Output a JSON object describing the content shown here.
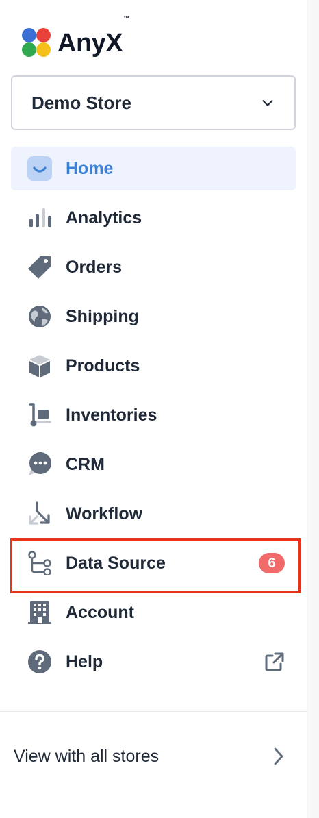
{
  "brand": {
    "name": "AnyX",
    "trademark": "™",
    "logo_colors": [
      "#3b6fd4",
      "#e8413a",
      "#2fa84f",
      "#f5c01a"
    ]
  },
  "store_selector": {
    "value": "Demo Store",
    "icon": "chevron-down-icon"
  },
  "nav": {
    "items": [
      {
        "label": "Home",
        "icon": "home-smile-icon",
        "active": true
      },
      {
        "label": "Analytics",
        "icon": "bar-chart-icon"
      },
      {
        "label": "Orders",
        "icon": "tag-icon"
      },
      {
        "label": "Shipping",
        "icon": "globe-icon"
      },
      {
        "label": "Products",
        "icon": "box-icon"
      },
      {
        "label": "Inventories",
        "icon": "hand-truck-icon"
      },
      {
        "label": "CRM",
        "icon": "chat-bubble-icon"
      },
      {
        "label": "Workflow",
        "icon": "workflow-arrow-icon"
      },
      {
        "label": "Data Source",
        "icon": "git-branch-icon",
        "badge": "6"
      },
      {
        "label": "Account",
        "icon": "building-icon"
      },
      {
        "label": "Help",
        "icon": "question-circle-icon",
        "trailing_icon": "external-link-icon"
      }
    ]
  },
  "footer": {
    "all_stores_label": "View with all stores",
    "icon": "chevron-right-icon"
  },
  "colors": {
    "active_bg": "#eef3fd",
    "active_text": "#3b82d6",
    "icon_gray": "#5f6b7a",
    "badge_bg": "#f26b6b",
    "highlight": "#e8321a"
  }
}
